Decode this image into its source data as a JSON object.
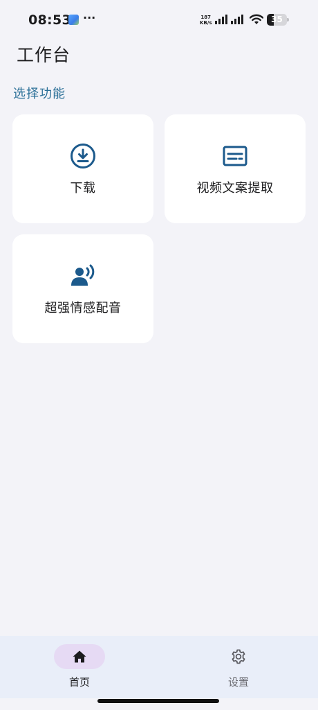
{
  "status_bar": {
    "time": "08:53",
    "dots": "···",
    "net_speed_value": "187",
    "net_speed_unit": "KB/s",
    "battery_level": "35",
    "icons": [
      "app-notification-icon",
      "signal-icon",
      "wifi-icon",
      "battery-icon"
    ]
  },
  "header": {
    "title": "工作台"
  },
  "section": {
    "label": "选择功能"
  },
  "features": [
    {
      "label": "下载",
      "icon": "download-icon"
    },
    {
      "label": "视频文案提取",
      "icon": "subtitles-icon"
    },
    {
      "label": "超强情感配音",
      "icon": "voice-over-icon"
    }
  ],
  "bottom_nav": {
    "items": [
      {
        "label": "首页",
        "icon": "home-icon",
        "active": true
      },
      {
        "label": "设置",
        "icon": "gear-icon",
        "active": false
      }
    ]
  },
  "colors": {
    "accent": "#1c5a8c",
    "section_label": "#2a6f97",
    "background": "#f3f3f8",
    "card": "#ffffff",
    "nav_background": "#e9eef9",
    "nav_active_pill": "#e6daf4"
  }
}
